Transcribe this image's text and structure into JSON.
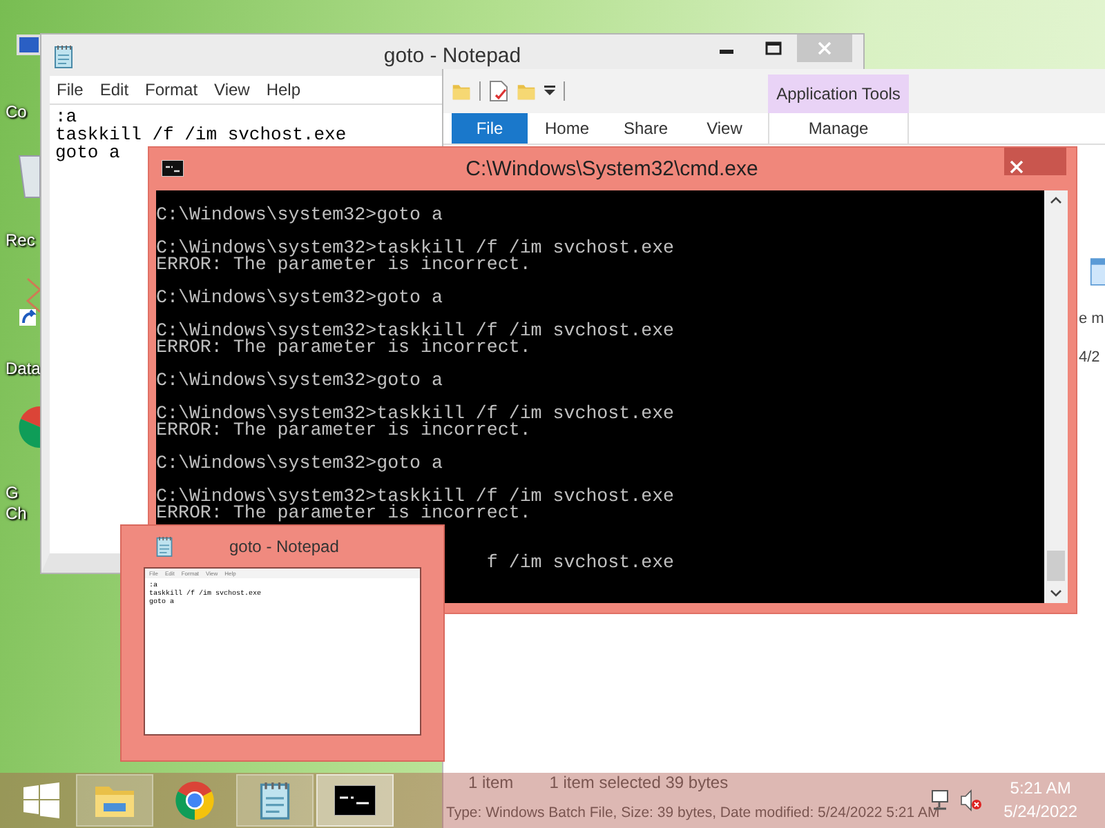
{
  "desktop_icons": [
    {
      "kind": "computer",
      "labels": [
        "Co"
      ]
    },
    {
      "kind": "recycle",
      "labels": [
        "Rec"
      ]
    },
    {
      "kind": "shortcut",
      "labels": [
        "Data"
      ]
    },
    {
      "kind": "chrome",
      "labels": [
        "G",
        "Ch"
      ]
    }
  ],
  "notepad": {
    "title": "goto - Notepad",
    "menu": [
      "File",
      "Edit",
      "Format",
      "View",
      "Help"
    ],
    "lines": [
      ":a",
      "taskkill /f /im svchost.exe",
      "goto a"
    ]
  },
  "explorer": {
    "context_tab": "Application Tools",
    "tabs": [
      {
        "label": "File",
        "kind": "file"
      },
      {
        "label": "Home",
        "kind": "tab"
      },
      {
        "label": "Share",
        "kind": "tab"
      },
      {
        "label": "View",
        "kind": "tab"
      },
      {
        "label": "Manage",
        "kind": "context"
      }
    ],
    "column_texts": [
      "e m",
      "4/2"
    ],
    "status": {
      "count": "1 item",
      "selection": "1 item selected  39 bytes"
    },
    "details": "Type: Windows Batch File, Size: 39 bytes, Date modified: 5/24/2022 5:21 AM"
  },
  "cmd": {
    "title": "C:\\Windows\\System32\\cmd.exe",
    "blocks": [
      {
        "kind": "lines",
        "lines": [
          "C:\\Windows\\system32>goto a"
        ]
      },
      {
        "kind": "lines",
        "lines": [
          "C:\\Windows\\system32>taskkill /f /im svchost.exe",
          "ERROR: The parameter is incorrect."
        ]
      },
      {
        "kind": "lines",
        "lines": [
          "C:\\Windows\\system32>goto a"
        ]
      },
      {
        "kind": "lines",
        "lines": [
          "C:\\Windows\\system32>taskkill /f /im svchost.exe",
          "ERROR: The parameter is incorrect."
        ]
      },
      {
        "kind": "lines",
        "lines": [
          "C:\\Windows\\system32>goto a"
        ]
      },
      {
        "kind": "lines",
        "lines": [
          "C:\\Windows\\system32>taskkill /f /im svchost.exe",
          "ERROR: The parameter is incorrect."
        ]
      },
      {
        "kind": "lines",
        "lines": [
          "C:\\Windows\\system32>goto a"
        ]
      },
      {
        "kind": "lines",
        "lines": [
          "C:\\Windows\\system32>taskkill /f /im svchost.exe",
          "ERROR: The parameter is incorrect."
        ]
      },
      {
        "kind": "tail",
        "lines": [
          "f /im svchost.exe"
        ]
      }
    ]
  },
  "thumbnail": {
    "title": "goto - Notepad",
    "menu": [
      "File",
      "Edit",
      "Format",
      "View",
      "Help"
    ],
    "lines": [
      ":a",
      "taskkill /f /im svchost.exe",
      "goto a"
    ]
  },
  "taskbar": {
    "items": [
      {
        "kind": "start",
        "running": false,
        "selected": false
      },
      {
        "kind": "explorer",
        "running": true,
        "selected": false
      },
      {
        "kind": "chrome",
        "running": false,
        "selected": false
      },
      {
        "kind": "notepad",
        "running": true,
        "selected": false
      },
      {
        "kind": "cmd",
        "running": true,
        "selected": true
      }
    ],
    "time": "5:21 AM",
    "date": "5/24/2022"
  }
}
